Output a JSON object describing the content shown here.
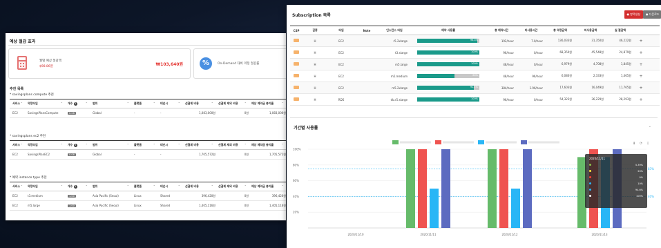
{
  "left_panel": {
    "title": "예상 절감 효과",
    "card1": {
      "label": "월별 예상 절감액",
      "sub": "$98.86원",
      "value": "₩103,640원"
    },
    "card2": {
      "label": "On-Demand 대비 약정 절감률"
    },
    "recommend_title": "추천 목록",
    "sections": [
      {
        "title": "* savingsplans compute 추천",
        "headers": [
          "서비스",
          "약정타입",
          "개수",
          "범위",
          "플랫폼",
          "테넌시",
          "선결제 비용",
          "선결제 제외 비용",
          "예상 예약금 총지출"
        ],
        "rows": [
          [
            "EC2",
            "SavingsPlansCompute",
            "0.08",
            "Global",
            "-",
            "-",
            "1,083,000원",
            "0원",
            "1,083,000원"
          ]
        ]
      },
      {
        "title": "* savingsplans ec2 추천",
        "headers": [
          "서비스",
          "약정타입",
          "개수",
          "범위",
          "플랫폼",
          "테넌시",
          "선결제 비용",
          "선결제 제외 비용",
          "예상 예약금 총지출"
        ],
        "rows": [
          [
            "EC2",
            "SavingsPlanEC2",
            "0.06",
            "Global",
            "-",
            "-",
            "1,705,572원",
            "0원",
            "1,705,572원"
          ]
        ]
      },
      {
        "title": "* 예약 instance type 추천",
        "headers": [
          "서비스",
          "약정타입",
          "개수",
          "범위",
          "플랫폼",
          "테넌시",
          "선결제 비용",
          "선결제 제외 비용",
          "예상 예약금 총지출"
        ],
        "rows": [
          [
            "EC2",
            "t3.medium",
            "1.00",
            "Asia Pacific (Seoul)",
            "Linux",
            "Shared",
            "396,420원",
            "0원",
            "396,420원"
          ],
          [
            "EC2",
            "m5.large",
            "1.00",
            "Asia Pacific (Seoul)",
            "Linux",
            "Shared",
            "1,405,116원",
            "0원",
            "1,405,116원"
          ]
        ]
      }
    ]
  },
  "right_panel": {
    "title": "Subscription 목록",
    "btn_red": "● 항목생성",
    "btn_gray": "● 다운로드",
    "headers": [
      "CSP",
      "권종",
      "타입",
      "Note",
      "인스턴스 타입",
      "예약 사용률",
      "총 예약시간",
      "미사용시간",
      "총 약정금액",
      "미사용금액",
      "실 절감액"
    ],
    "rows": [
      [
        "",
        "H",
        "EC2",
        "",
        "r5.2xlarge",
        "96.4%",
        "192/hour",
        "7.0/hour",
        "136,033원",
        "31,350원",
        "46,222원"
      ],
      [
        "",
        "H",
        "EC2",
        "",
        "t3.xlarge",
        "100%",
        "96/hour",
        "0/hour",
        "68,350원",
        "45,548원",
        "24,879원"
      ],
      [
        "",
        "H",
        "EC2",
        "",
        "m5.large",
        "100%",
        "48/hour",
        "0/hour",
        "6,979원",
        "4,708원",
        "1,845원"
      ],
      [
        "",
        "H",
        "EC2",
        "",
        "m5.medium",
        "60%",
        "48/hour",
        "96/hour",
        "6,080원",
        "2,333원",
        "1,465원"
      ],
      [
        "",
        "H",
        "EC2",
        "",
        "m5.2xlarge",
        "91.1%",
        "384/hour",
        "1.96/hour",
        "17,603원",
        "16,049원",
        "11,765원"
      ],
      [
        "",
        "H",
        "RDS",
        "",
        "db.r5.xlarge",
        "100%",
        "96/hour",
        "0/hour",
        "54,323원",
        "36,229원",
        "28,293원"
      ]
    ],
    "usage": [
      0.964,
      1.0,
      1.0,
      0.6,
      0.911,
      1.0
    ],
    "chart_title": "기간별 사용률",
    "tooltip": {
      "title": "2020/11/11",
      "values": [
        "5.39%",
        "20%",
        "0%",
        "10%",
        "94.6%",
        "100%"
      ],
      "colors": [
        "#8bc34a",
        "#ffeb3b",
        "#f44336",
        "#29b6f6",
        "#29b6f6",
        "#ffffff"
      ]
    }
  },
  "chart_data": {
    "type": "bar",
    "categories": [
      "2020/11/10",
      "2020/11/11",
      "2020/11/12",
      "2020/11/13"
    ],
    "series": [
      {
        "name": "",
        "color": "#66bb6a",
        "values": [
          0,
          100,
          100,
          90
        ]
      },
      {
        "name": "",
        "color": "#ef5350",
        "values": [
          0,
          100,
          100,
          100
        ]
      },
      {
        "name": "",
        "color": "#29b6f6",
        "values": [
          0,
          50,
          50,
          90
        ]
      },
      {
        "name": "",
        "color": "#5c6bc0",
        "values": [
          0,
          100,
          100,
          100
        ]
      }
    ],
    "y_ticks": [
      "100%",
      "80%",
      "60%",
      "40%",
      "20%"
    ],
    "ylim": [
      0,
      100
    ],
    "ref_lines": [
      75,
      40
    ],
    "ref_labels": [
      "83%",
      "40%"
    ],
    "grid": true
  }
}
